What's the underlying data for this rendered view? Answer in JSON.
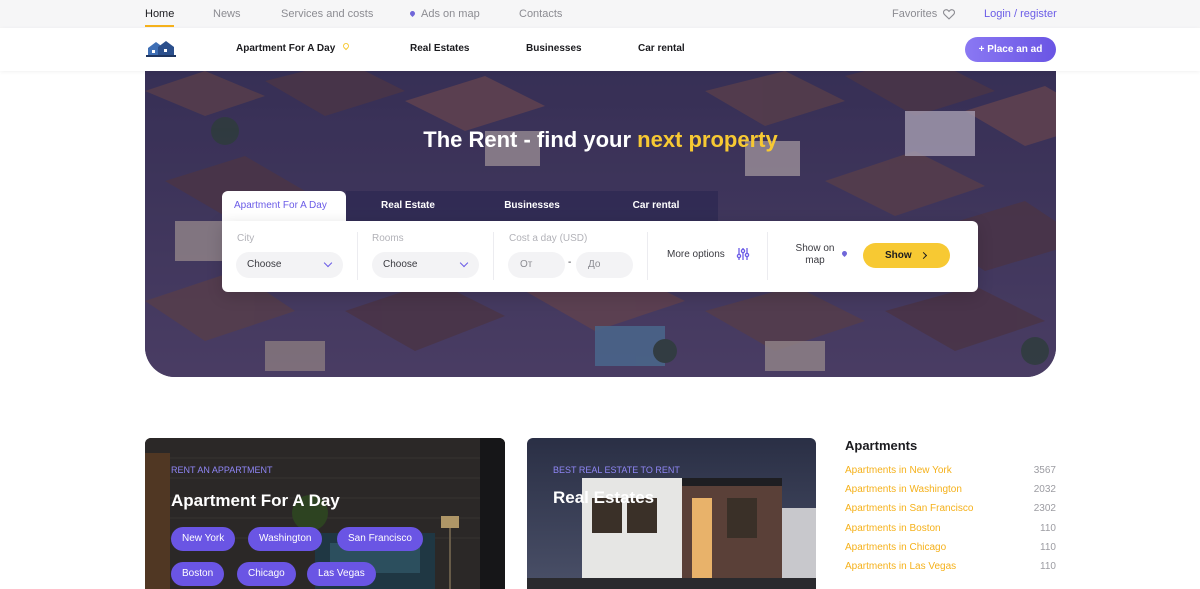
{
  "topbar": {
    "links": [
      "Home",
      "News",
      "Services and costs",
      "Ads on map",
      "Contacts"
    ],
    "favorites": "Favorites",
    "login": "Login / register"
  },
  "mainnav": {
    "categories": [
      "Apartment For A Day",
      "Real Estates",
      "Businesses",
      "Car rental"
    ],
    "place_ad": "+ Place an ad"
  },
  "hero": {
    "title_main": "The Rent - find your ",
    "title_accent": "next property"
  },
  "search": {
    "tabs": [
      "Apartment For A Day",
      "Real Estate",
      "Businesses",
      "Car rental"
    ],
    "city_label": "City",
    "city_value": "Choose",
    "rooms_label": "Rooms",
    "rooms_value": "Choose",
    "cost_label": "Cost a day (USD)",
    "cost_from": "От",
    "cost_dash": "-",
    "cost_to": "До",
    "more_options": "More options",
    "show_on_map": "Show on map",
    "show_button": "Show"
  },
  "cards": [
    {
      "subtitle": "RENT AN APPARTMENT",
      "title": "Apartment For A Day",
      "chips": [
        "New York",
        "Washington",
        "San Francisco",
        "Boston",
        "Chicago",
        "Las Vegas"
      ]
    },
    {
      "subtitle": "BEST REAL ESTATE TO RENT",
      "title": "Real Estates"
    }
  ],
  "sidebar": {
    "title": "Apartments",
    "items": [
      {
        "label": "Apartments in New York",
        "count": "3567"
      },
      {
        "label": "Apartments in Washington",
        "count": "2032"
      },
      {
        "label": "Apartments in San Francisco",
        "count": "2302"
      },
      {
        "label": "Apartments in Boston",
        "count": "110"
      },
      {
        "label": "Apartments in Chicago",
        "count": "110"
      },
      {
        "label": "Apartments in Las Vegas",
        "count": "110"
      }
    ]
  },
  "colors": {
    "accent_purple": "#6b5ce7",
    "accent_yellow": "#f7c933",
    "link_orange": "#f5b11b"
  }
}
